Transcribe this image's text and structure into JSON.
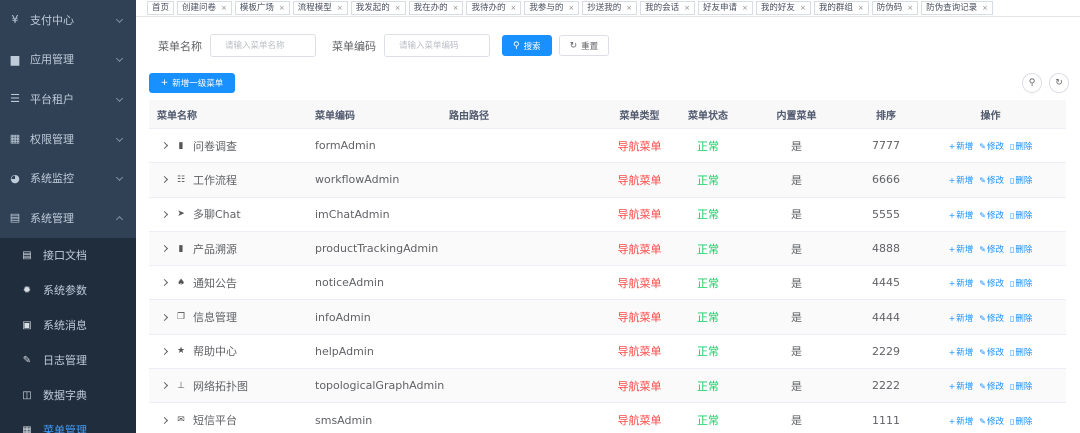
{
  "sidebar": {
    "items": [
      {
        "label": "支付中心",
        "icon": "yen-icon",
        "glyph": "¥",
        "open": false
      },
      {
        "label": "应用管理",
        "icon": "lock-icon",
        "glyph": "▆",
        "open": false
      },
      {
        "label": "平台租户",
        "icon": "list-icon",
        "glyph": "☰",
        "open": false
      },
      {
        "label": "权限管理",
        "icon": "grid-icon",
        "glyph": "▦",
        "open": false
      },
      {
        "label": "系统监控",
        "icon": "globe-icon",
        "glyph": "◕",
        "open": false
      },
      {
        "label": "系统管理",
        "icon": "document-icon",
        "glyph": "▤",
        "open": true
      }
    ],
    "sub_items": [
      {
        "label": "接口文档",
        "icon": "doc-icon",
        "glyph": "▤",
        "active": false
      },
      {
        "label": "系统参数",
        "icon": "gear-icon",
        "glyph": "✹",
        "active": false
      },
      {
        "label": "系统消息",
        "icon": "message-icon",
        "glyph": "▣",
        "active": false
      },
      {
        "label": "日志管理",
        "icon": "edit-log-icon",
        "glyph": "✎",
        "active": false
      },
      {
        "label": "数据字典",
        "icon": "dictionary-icon",
        "glyph": "◫",
        "active": false
      },
      {
        "label": "菜单管理",
        "icon": "menu-icon",
        "glyph": "▦",
        "active": true
      }
    ]
  },
  "tags": [
    "首页",
    "创建问卷",
    "模板广场",
    "流程模型",
    "我发起的",
    "我在办的",
    "我待办的",
    "我参与的",
    "抄送我的",
    "我的会话",
    "好友申请",
    "我的好友",
    "我的群组",
    "防伪码",
    "防伪查询记录"
  ],
  "search": {
    "name_label": "菜单名称",
    "name_placeholder": "请输入菜单名称",
    "code_label": "菜单编码",
    "code_placeholder": "请输入菜单编码",
    "search_label": "搜索",
    "reset_label": "重置"
  },
  "toolbar": {
    "add_label": "新增一级菜单"
  },
  "table": {
    "headers": {
      "name": "菜单名称",
      "code": "菜单编码",
      "path": "路由路径",
      "type": "菜单类型",
      "status": "菜单状态",
      "builtin": "内置菜单",
      "sort": "排序",
      "ops": "操作"
    },
    "ops": {
      "add": "新增",
      "edit": "修改",
      "delete": "删除"
    },
    "rows": [
      {
        "name": "问卷调查",
        "icon": "survey-icon",
        "glyph": "▮",
        "code": "formAdmin",
        "path": "",
        "type": "导航菜单",
        "status": "正常",
        "builtin": "是",
        "sort": "7777"
      },
      {
        "name": "工作流程",
        "icon": "workflow-icon",
        "glyph": "☷",
        "code": "workflowAdmin",
        "path": "",
        "type": "导航菜单",
        "status": "正常",
        "builtin": "是",
        "sort": "6666"
      },
      {
        "name": "多聊Chat",
        "icon": "send-icon",
        "glyph": "➤",
        "code": "imChatAdmin",
        "path": "",
        "type": "导航菜单",
        "status": "正常",
        "builtin": "是",
        "sort": "5555"
      },
      {
        "name": "产品溯源",
        "icon": "trace-icon",
        "glyph": "▮",
        "code": "productTrackingAdmin",
        "path": "",
        "type": "导航菜单",
        "status": "正常",
        "builtin": "是",
        "sort": "4888"
      },
      {
        "name": "通知公告",
        "icon": "bell-icon",
        "glyph": "♠",
        "code": "noticeAdmin",
        "path": "",
        "type": "导航菜单",
        "status": "正常",
        "builtin": "是",
        "sort": "4445"
      },
      {
        "name": "信息管理",
        "icon": "copy-icon",
        "glyph": "❐",
        "code": "infoAdmin",
        "path": "",
        "type": "导航菜单",
        "status": "正常",
        "builtin": "是",
        "sort": "4444"
      },
      {
        "name": "帮助中心",
        "icon": "star-icon",
        "glyph": "★",
        "code": "helpAdmin",
        "path": "",
        "type": "导航菜单",
        "status": "正常",
        "builtin": "是",
        "sort": "2229"
      },
      {
        "name": "网络拓扑图",
        "icon": "topology-icon",
        "glyph": "⊥",
        "code": "topologicalGraphAdmin",
        "path": "",
        "type": "导航菜单",
        "status": "正常",
        "builtin": "是",
        "sort": "2222"
      },
      {
        "name": "短信平台",
        "icon": "mail-icon",
        "glyph": "✉",
        "code": "smsAdmin",
        "path": "",
        "type": "导航菜单",
        "status": "正常",
        "builtin": "是",
        "sort": "1111"
      }
    ]
  },
  "colors": {
    "sidebar_bg": "#304156",
    "submenu_bg": "#1f2d3d",
    "primary": "#1890ff",
    "danger": "#ff4949",
    "success": "#13ce66"
  }
}
